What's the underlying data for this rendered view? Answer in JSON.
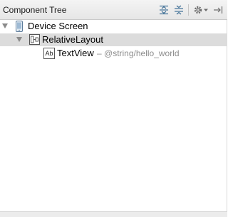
{
  "panel": {
    "title": "Component Tree",
    "toolbar": {
      "expand_all_icon": "expand-all-icon",
      "collapse_all_icon": "collapse-all-icon",
      "settings_icon": "gear-icon",
      "dropdown_icon": "chevron-down-icon",
      "hide_icon": "hide-panel-icon"
    }
  },
  "tree": {
    "device": {
      "label": "Device Screen",
      "icon": "device-icon"
    },
    "layout": {
      "label": "RelativeLayout",
      "icon": "relative-layout-icon"
    },
    "textview": {
      "label": "TextView",
      "hint": "– @string/hello_world",
      "icon": "textview-icon",
      "icon_text": "Ab"
    }
  },
  "colors": {
    "selected_row": "#dcdcdc",
    "hint_text": "#8c8c8c",
    "header_bg": "#e9e9e9"
  }
}
